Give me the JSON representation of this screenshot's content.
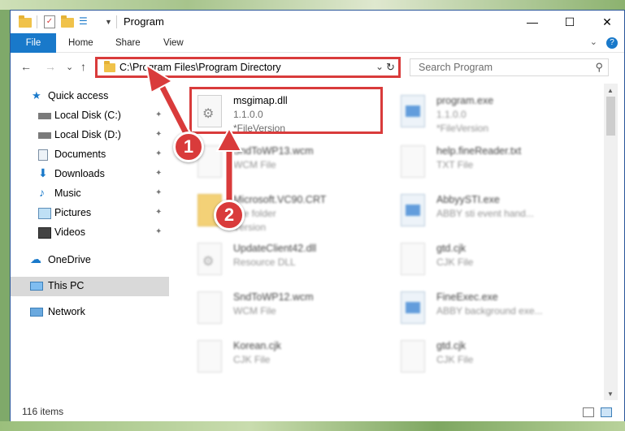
{
  "window": {
    "title": "Program",
    "minimize_glyph": "—",
    "maximize_glyph": "☐",
    "close_glyph": "✕"
  },
  "ribbon": {
    "tabs": [
      "File",
      "Home",
      "Share",
      "View"
    ],
    "expand_glyph": "⌄",
    "help_glyph": "?"
  },
  "nav": {
    "back_glyph": "←",
    "forward_glyph": "→",
    "recent_glyph": "⌄",
    "up_glyph": "↑",
    "address": "C:\\Program Files\\Program Directory",
    "address_dropdown_glyph": "⌄",
    "refresh_glyph": "↻",
    "search_placeholder": "Search Program",
    "search_glyph": "⚲"
  },
  "sidebar": {
    "items": [
      {
        "label": "Quick access",
        "icon": "star-icon"
      },
      {
        "label": "Local Disk (C:)",
        "icon": "drive-icon",
        "pinned": true
      },
      {
        "label": "Local Disk (D:)",
        "icon": "drive-icon",
        "pinned": true
      },
      {
        "label": "Documents",
        "icon": "documents-icon",
        "pinned": true
      },
      {
        "label": "Downloads",
        "icon": "download-icon",
        "pinned": true
      },
      {
        "label": "Music",
        "icon": "music-icon",
        "pinned": true
      },
      {
        "label": "Pictures",
        "icon": "pictures-icon",
        "pinned": true
      },
      {
        "label": "Videos",
        "icon": "videos-icon",
        "pinned": true
      },
      {
        "label": "OneDrive",
        "icon": "cloud-icon"
      },
      {
        "label": "This PC",
        "icon": "computer-icon",
        "selected": true
      },
      {
        "label": "Network",
        "icon": "network-icon"
      }
    ],
    "pin_glyph": "📌"
  },
  "files": [
    {
      "name": "msgimap.dll",
      "line2": "1.1.0.0",
      "line3": "*FileVersion",
      "icon": "dll-icon",
      "highlighted": true
    },
    {
      "name": "program.exe",
      "line2": "1.1.0.0",
      "line3": "*FileVersion",
      "icon": "exe-icon"
    },
    {
      "name": "SndToWP13.wcm",
      "line2": "WCM File",
      "icon": "file-icon"
    },
    {
      "name": "help.fineReader.txt",
      "line2": "TXT File",
      "icon": "file-icon"
    },
    {
      "name": "Microsoft.VC90.CRT",
      "line2": "File folder",
      "line3": "Version",
      "icon": "folder-icon"
    },
    {
      "name": "AbbyySTI.exe",
      "line2": "ABBY sti event hand...",
      "icon": "exe-icon"
    },
    {
      "name": "UpdateClient42.dll",
      "line2": "Resource DLL",
      "icon": "dll-icon"
    },
    {
      "name": "gtd.cjk",
      "line2": "CJK File",
      "icon": "file-icon"
    },
    {
      "name": "SndToWP12.wcm",
      "line2": "WCM File",
      "icon": "file-icon"
    },
    {
      "name": "FineExec.exe",
      "line2": "ABBY background exe...",
      "icon": "exe-icon"
    },
    {
      "name": "Korean.cjk",
      "line2": "CJK File",
      "icon": "file-icon"
    },
    {
      "name": "gtd.cjk",
      "line2": "CJK File",
      "icon": "file-icon"
    }
  ],
  "status": {
    "items_count": "116 items"
  },
  "callouts": {
    "one": "1",
    "two": "2",
    "color": "#d93b3b"
  }
}
